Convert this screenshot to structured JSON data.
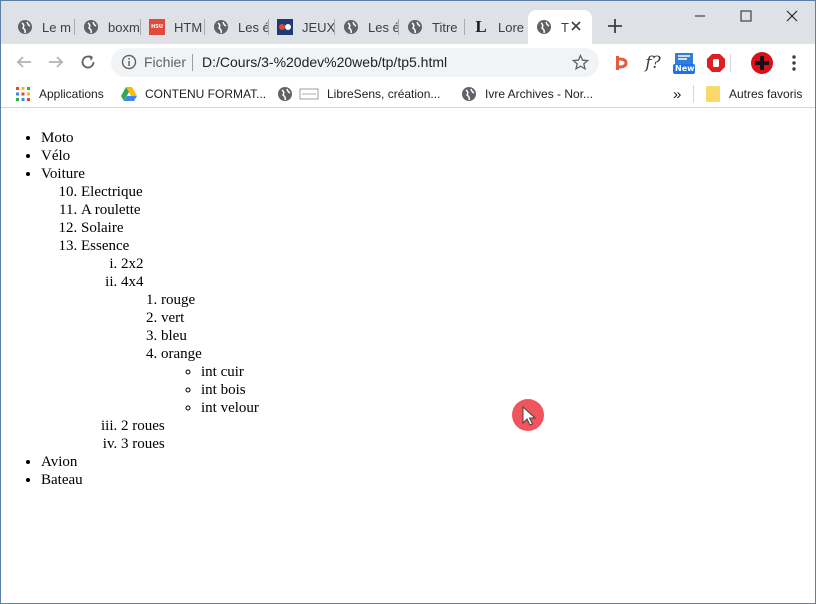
{
  "tabs": [
    {
      "title": "Le m",
      "icon": "globe-icon"
    },
    {
      "title": "boxm",
      "icon": "globe-icon"
    },
    {
      "title": "HTM",
      "icon": "hsu-icon",
      "icon_text": "HSU"
    },
    {
      "title": "Les é",
      "icon": "globe-icon"
    },
    {
      "title": "JEUX",
      "icon": "game-icon"
    },
    {
      "title": "Les é",
      "icon": "globe-icon"
    },
    {
      "title": "Titre",
      "icon": "globe-icon"
    },
    {
      "title": "Lore",
      "icon": "letter-l-icon",
      "icon_text": "L"
    },
    {
      "title": "T",
      "icon": "globe-icon",
      "active": true
    }
  ],
  "address": {
    "scheme": "Fichier",
    "url": "D:/Cours/3-%20dev%20web/tp/tp5.html"
  },
  "extensions": {
    "f_label": "f?",
    "new_badge": "New"
  },
  "bookmarks": {
    "items": [
      {
        "label": "Applications",
        "icon": "apps-grid-icon"
      },
      {
        "label": "CONTENU FORMAT...",
        "icon": "google-drive-icon"
      },
      {
        "label": "LibreSens, création...",
        "icon": "globe-icon"
      },
      {
        "label": "Ivre Archives - Nor...",
        "icon": "globe-icon"
      }
    ],
    "overflow": "»",
    "other": "Autres favoris"
  },
  "page": {
    "list": {
      "moto": "Moto",
      "velo": "Vélo",
      "voiture": "Voiture",
      "voiture_sub": {
        "electrique": "Electrique",
        "roulette": "A roulette",
        "solaire": "Solaire",
        "essence": "Essence",
        "essence_sub": {
          "a": "2x2",
          "b": "4x4",
          "colors": {
            "rouge": "rouge",
            "vert": "vert",
            "bleu": "bleu",
            "orange": "orange",
            "interiors": {
              "cuir": "int cuir",
              "bois": "int bois",
              "velour": "int velour"
            }
          },
          "c": "2 roues",
          "d": "3 roues"
        }
      },
      "avion": "Avion",
      "bateau": "Bateau"
    }
  },
  "colors": {
    "tabstrip": "#dee1e6",
    "omnibox": "#f1f3f4",
    "cursor_halo": "#f0545c"
  }
}
